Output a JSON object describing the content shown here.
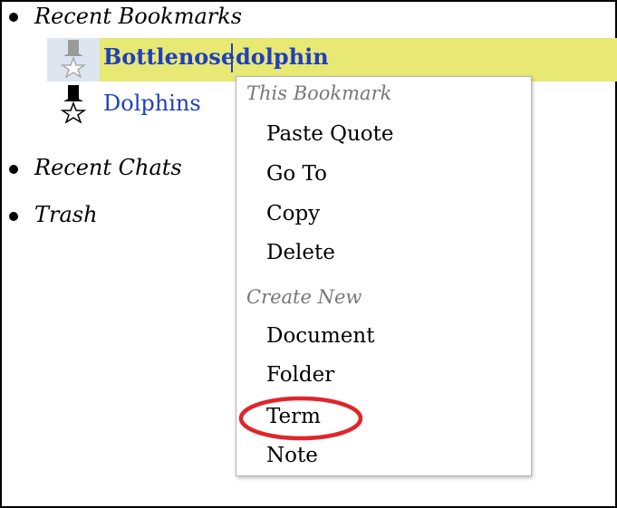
{
  "tree": {
    "sections": [
      {
        "label": "Recent Bookmarks"
      },
      {
        "label": "Recent Chats"
      },
      {
        "label": "Trash"
      }
    ],
    "bookmarks": [
      {
        "title_part1": "Bottlenose",
        "title_part2": "dolphin",
        "icon": "bookmark-star-icon",
        "state": "selected"
      },
      {
        "title": "Dolphins",
        "icon": "bookmark-star-icon",
        "state": "normal"
      }
    ]
  },
  "context_menu": {
    "group1_header": "This Bookmark",
    "group1_items": [
      "Paste Quote",
      "Go To",
      "Copy",
      "Delete"
    ],
    "group2_header": "Create New",
    "group2_items": [
      "Document",
      "Folder",
      "Term",
      "Note"
    ],
    "highlighted_item": "Term"
  },
  "colors": {
    "link_blue": "#1f3fbf",
    "selection_blue": "#dde6f0",
    "selection_yellow": "#e8e874",
    "annotation_red": "#e0252b",
    "menu_header_gray": "#777777"
  }
}
